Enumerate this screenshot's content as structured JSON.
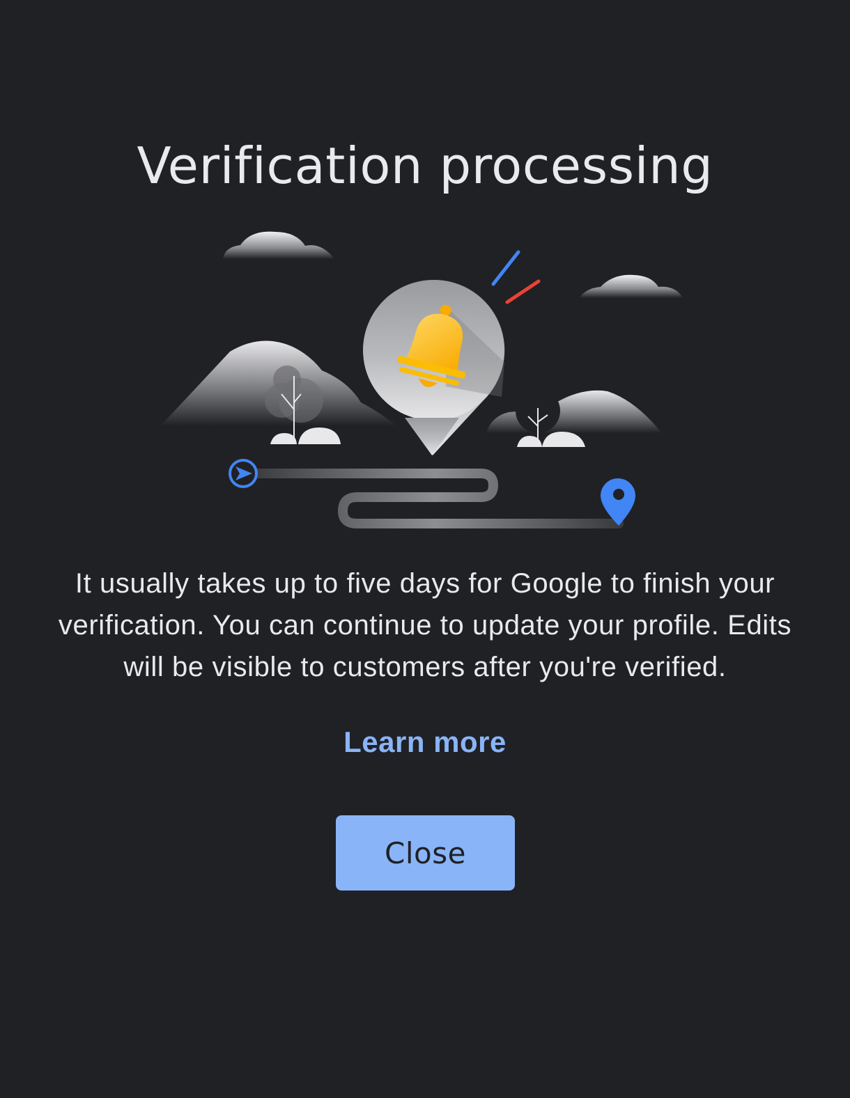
{
  "dialog": {
    "title": "Verification processing",
    "body": "It usually takes up to five days for Google to finish your verification. You can continue to update your profile. Edits will be visible to customers after you're verified.",
    "learn_more_label": "Learn more",
    "close_label": "Close"
  },
  "illustration": {
    "icons": [
      "cloud-icon",
      "mountain-icon",
      "tree-icon",
      "bush-icon",
      "bell-icon",
      "location-pin-icon",
      "navigation-arrow-icon",
      "route-path"
    ],
    "colors": {
      "background": "#202124",
      "accent_blue": "#4285f4",
      "accent_red": "#ea4335",
      "bell_yellow": "#fbbc04",
      "link_blue": "#8ab4f8",
      "text": "#e8eaed"
    }
  }
}
